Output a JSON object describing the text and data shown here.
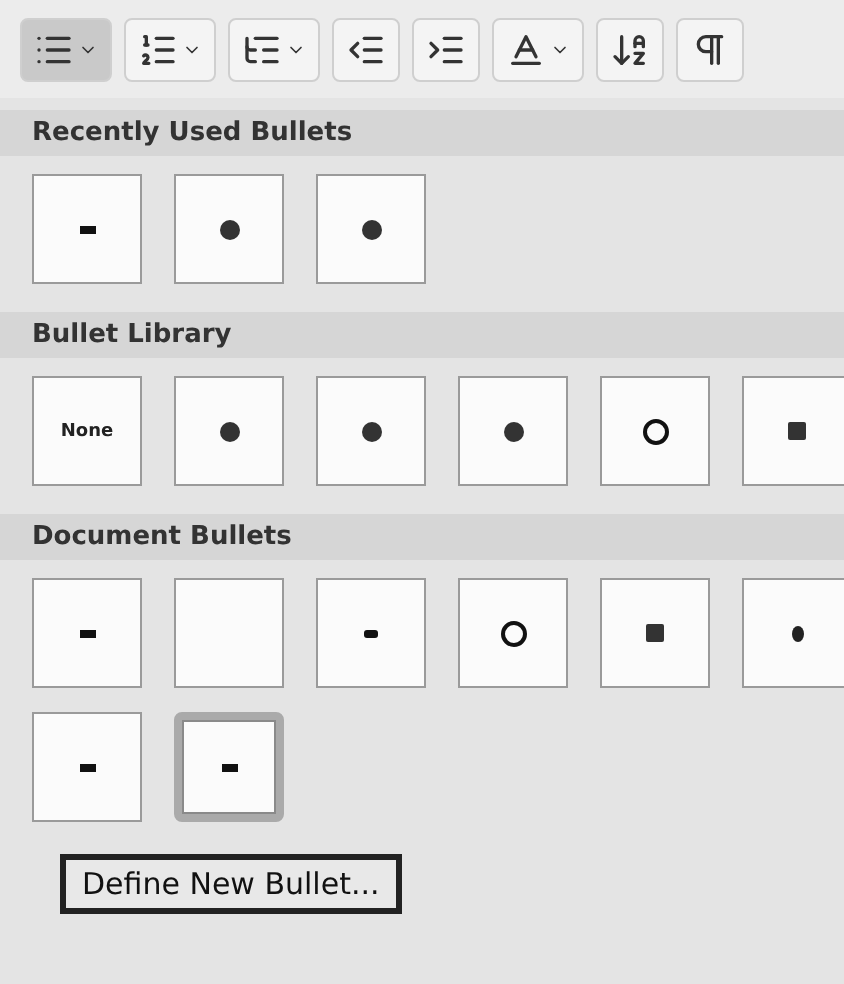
{
  "toolbar": [
    {
      "kind": "bullets",
      "selected": true,
      "dropdown": true
    },
    {
      "kind": "numbering",
      "selected": false,
      "dropdown": true
    },
    {
      "kind": "multilevel",
      "selected": false,
      "dropdown": true
    },
    {
      "kind": "outdent",
      "selected": false,
      "dropdown": false
    },
    {
      "kind": "indent",
      "selected": false,
      "dropdown": false
    },
    {
      "kind": "text-effects",
      "selected": false,
      "dropdown": true
    },
    {
      "kind": "sort",
      "selected": false,
      "dropdown": false
    },
    {
      "kind": "pilcrow",
      "selected": false,
      "dropdown": false
    }
  ],
  "sections": [
    {
      "title": "Recently Used Bullets",
      "rows": [
        [
          {
            "kind": "dash",
            "selected": false
          },
          {
            "kind": "dot",
            "selected": false
          },
          {
            "kind": "dot",
            "selected": false
          }
        ]
      ]
    },
    {
      "title": "Bullet Library",
      "rows": [
        [
          {
            "kind": "text",
            "label": "None",
            "selected": false
          },
          {
            "kind": "dot",
            "selected": false
          },
          {
            "kind": "dot",
            "selected": false
          },
          {
            "kind": "dot",
            "selected": false
          },
          {
            "kind": "circle",
            "selected": false
          },
          {
            "kind": "square",
            "selected": false
          }
        ]
      ]
    },
    {
      "title": "Document Bullets",
      "rows": [
        [
          {
            "kind": "dash",
            "selected": false
          },
          {
            "kind": "empty",
            "selected": false
          },
          {
            "kind": "small-dash",
            "selected": false
          },
          {
            "kind": "circle",
            "selected": false
          },
          {
            "kind": "square",
            "selected": false
          },
          {
            "kind": "small-dot",
            "selected": false
          }
        ],
        [
          {
            "kind": "dash",
            "selected": false
          },
          {
            "kind": "dash",
            "selected": true
          }
        ]
      ]
    }
  ],
  "define_button": "Define New Bullet..."
}
